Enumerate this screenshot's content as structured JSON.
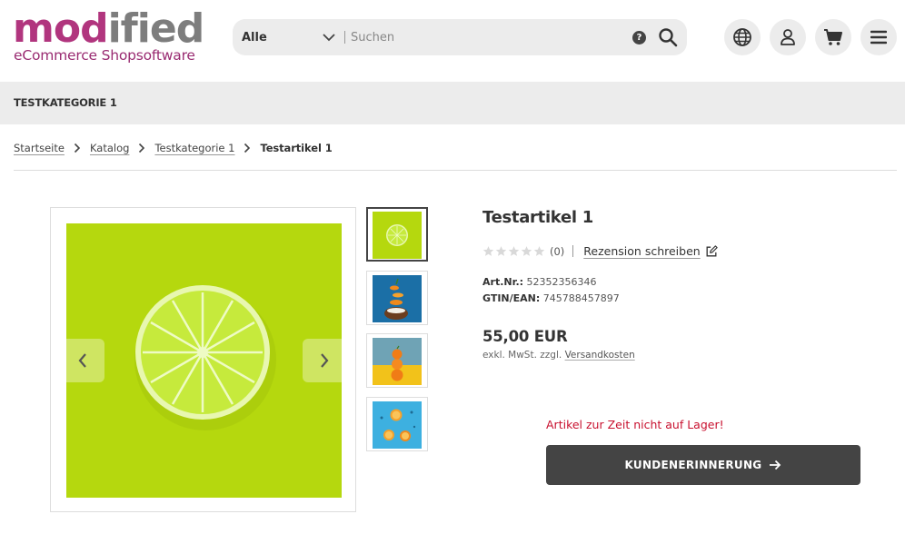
{
  "logo": {
    "text_part1": "mod",
    "text_part2": "ified",
    "tagline": "eCommerce Shopsoftware",
    "color_primary": "#b1357e",
    "color_secondary": "#7d7d7d"
  },
  "search": {
    "category": "Alle",
    "placeholder": "Suchen",
    "help_label": "?"
  },
  "header_icons": [
    "globe-icon",
    "user-icon",
    "cart-icon",
    "menu-icon"
  ],
  "category_bar": {
    "items": [
      "TESTKATEGORIE 1"
    ]
  },
  "breadcrumb": {
    "items": [
      "Startseite",
      "Katalog",
      "Testkategorie 1"
    ],
    "current": "Testartikel 1"
  },
  "product": {
    "title": "Testartikel 1",
    "rating_count": "(0)",
    "rating_value": 0,
    "review_link": "Rezension schreiben",
    "art_nr_label": "Art.Nr.:",
    "art_nr": "52352356346",
    "gtin_label": "GTIN/EAN:",
    "gtin": "745788457897",
    "price": "55,00 EUR",
    "price_note_prefix": "exkl. MwSt. zzgl.",
    "shipping_link": "Versandkosten",
    "stock_message": "Artikel zur Zeit nicht auf Lager!",
    "reminder_button": "KUNDENERINNERUNG",
    "stock_color": "#c8102e"
  },
  "gallery": {
    "thumbnails": [
      "lime-slice",
      "orange-coconut-stack",
      "orange-stack-yellow",
      "oranges-blue"
    ],
    "active_index": 0
  }
}
